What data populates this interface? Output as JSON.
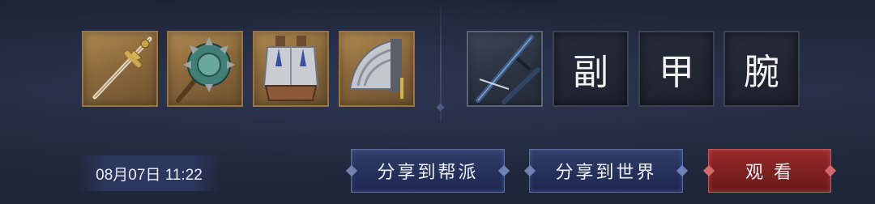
{
  "timestamp": "08月07日 11:22",
  "equipment": {
    "left_slots": [
      {
        "item": "golden-sword-icon"
      },
      {
        "item": "jade-spiked-mace-icon"
      },
      {
        "item": "silver-chest-armor-icon"
      },
      {
        "item": "steel-pauldron-icon"
      }
    ],
    "right_slots": [
      {
        "item": "blue-katana-icon"
      },
      {
        "label": "副"
      },
      {
        "label": "甲"
      },
      {
        "label": "腕"
      }
    ]
  },
  "buttons": {
    "share_guild": "分享到帮派",
    "share_world": "分享到世界",
    "watch": "观 看"
  },
  "colors": {
    "background": "#1e2538",
    "gold_frame": "#9a7440",
    "watch_red": "#7c1f1f",
    "share_blue": "#24305a"
  }
}
